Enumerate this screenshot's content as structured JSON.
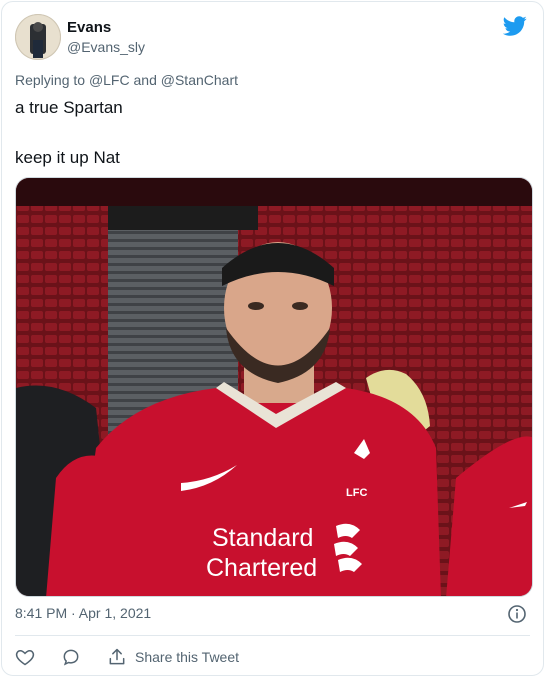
{
  "tweet": {
    "author_name": "Evans",
    "author_handle": "@Evans_sly",
    "reply_prefix": "Replying to",
    "reply_mentions": [
      "@LFC",
      "@StanChart"
    ],
    "reply_joiner": "and",
    "text_line1": "a true Spartan",
    "text_line2": "keep it up Nat",
    "timestamp": "8:41 PM · Apr 1, 2021"
  },
  "media": {
    "jersey_sponsor_line1": "Standard",
    "jersey_sponsor_line2": "Chartered",
    "crest_text": "LFC"
  },
  "actions": {
    "like_icon": "heart-icon",
    "reply_icon": "comment-icon",
    "share_icon": "share-icon",
    "share_label": "Share this Tweet"
  },
  "colors": {
    "twitter_blue": "#1d9bf0",
    "secondary_text": "#536471",
    "jersey_red": "#c8102e"
  }
}
